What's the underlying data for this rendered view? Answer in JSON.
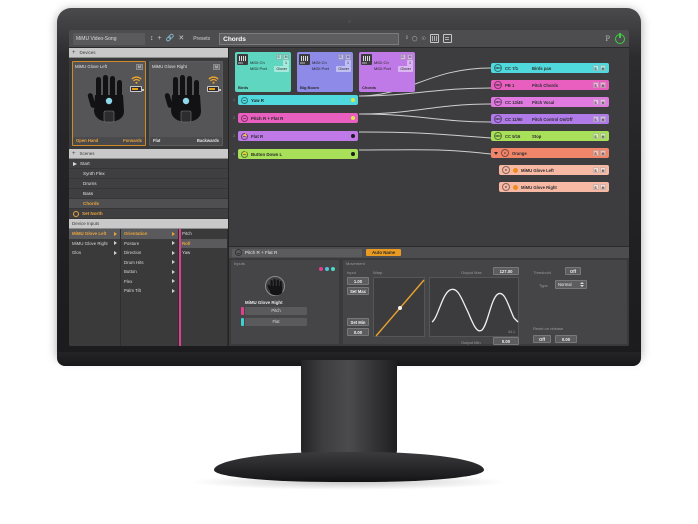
{
  "toolbar": {
    "song_title": "MiMU Video-Song",
    "icons": [
      "updown-arrows-icon",
      "plus-icon",
      "link-icon",
      "close-icon"
    ],
    "presets_label": "Presets",
    "scene_name_value": "Chords",
    "scene_name_placeholder": "Scene name",
    "right_icons": [
      "text-cursor-icon",
      "circle-icon",
      "balloon-icon",
      "keyboard-icon",
      "list-icon"
    ],
    "p_label": "P",
    "power_icon": "power-icon"
  },
  "devices_panel": {
    "header": "Devices",
    "items": [
      {
        "name": "MiMU Glove Left",
        "mute": "M",
        "posture": "Open Hand",
        "direction": "Forwards",
        "selected": true
      },
      {
        "name": "MiMU Glove Right",
        "mute": "M",
        "posture": "Flat",
        "direction": "Backwards",
        "selected": false
      }
    ]
  },
  "scenes_panel": {
    "header": "Scenes",
    "items": [
      {
        "label": "Start",
        "playing": true,
        "active": false,
        "gear": false
      },
      {
        "label": "Synth Flex",
        "playing": false,
        "active": false,
        "gear": false
      },
      {
        "label": "Drums",
        "playing": false,
        "active": false,
        "gear": false
      },
      {
        "label": "Bass",
        "playing": false,
        "active": false,
        "gear": false
      },
      {
        "label": "Chords",
        "playing": false,
        "active": true,
        "gear": false
      },
      {
        "label": "Set North",
        "playing": false,
        "active": false,
        "gear": true
      }
    ]
  },
  "device_inputs": {
    "header": "Device Inputs",
    "column_devices": [
      {
        "label": "MiMU Glove Left",
        "selected": true
      },
      {
        "label": "MiMU Glove Right",
        "selected": false
      },
      {
        "label": "Glos",
        "selected": false
      }
    ],
    "column_categories": [
      {
        "label": "Orientation",
        "selected": true
      },
      {
        "label": "Posture",
        "selected": false
      },
      {
        "label": "Direction",
        "selected": false
      },
      {
        "label": "Drum Hits",
        "selected": false
      },
      {
        "label": "Button",
        "selected": false
      },
      {
        "label": "Flex",
        "selected": false
      },
      {
        "label": "Palm Tilt",
        "selected": false
      }
    ],
    "column_values": [
      {
        "label": "Pitch",
        "selected": false
      },
      {
        "label": "Roll",
        "selected": true
      },
      {
        "label": "Yaw",
        "selected": false
      }
    ]
  },
  "canvas": {
    "midi_modules": [
      {
        "name": "Birds",
        "midi_ch_label": "MIDI Ch",
        "midi_ch": "1",
        "midi_port_label": "MIDI Port",
        "midi_port": "Glover",
        "solo": "S",
        "mute": "M",
        "color": "#5fd6c0"
      },
      {
        "name": "Big Boom",
        "midi_ch_label": "MIDI Ch",
        "midi_ch": "1",
        "midi_port_label": "MIDI Port",
        "midi_port": "Glover",
        "solo": "S",
        "mute": "M",
        "color": "#8e8ae8"
      },
      {
        "name": "Chords",
        "midi_ch_label": "MIDI Ch",
        "midi_ch": "1",
        "midi_port_label": "MIDI Port",
        "midi_port": "Glover",
        "solo": "S",
        "mute": "M",
        "color": "#c07ae8"
      }
    ],
    "source_nodes": [
      {
        "num": "1",
        "label": "Yaw R",
        "color": "#4fd9dd",
        "icon": "knob-icon",
        "dot": "#d9e84a"
      },
      {
        "num": "2",
        "label": "Pitch R + Flat R",
        "color": "#e85fc0",
        "icon": "knob-icon",
        "dot": "#d9e84a"
      },
      {
        "num": "3",
        "label": "Flat R",
        "color": "#c07ae8",
        "icon": "bolt-icon",
        "dot": "#1c1c1e"
      },
      {
        "num": "4",
        "label": "Button Down L",
        "color": "#a8e05a",
        "icon": "bolt-icon",
        "dot": "#1c1c1e"
      }
    ],
    "output_nodes": [
      {
        "cc": "CC 7/1",
        "label": "Birds pan",
        "color": "#4fd9dd",
        "solo": "S",
        "mute": "M",
        "type": "midi"
      },
      {
        "cc": "PB 1",
        "label": "Pitch Chords",
        "color": "#e85fc0",
        "solo": "S",
        "mute": "M",
        "type": "midi"
      },
      {
        "cc": "CC 13/45",
        "label": "Pitch Vocal",
        "color": "#e07ae0",
        "solo": "S",
        "mute": "M",
        "type": "midi"
      },
      {
        "cc": "CC 11/90",
        "label": "Pitch Control On/Off",
        "color": "#b07ae8",
        "solo": "S",
        "mute": "M",
        "type": "midi"
      },
      {
        "cc": "CC 5/16",
        "label": "Stop",
        "color": "#a8e05a",
        "solo": "S",
        "mute": "M",
        "type": "midi"
      }
    ],
    "group": {
      "label": "Orange",
      "color": "#f0856a",
      "solo": "S",
      "mute": "M",
      "children": [
        {
          "label": "MiMU Glove Left",
          "color": "#f7b8a4",
          "solo": "S",
          "mute": "M"
        },
        {
          "label": "MiMU Glove Right",
          "color": "#f7b8a4",
          "solo": "S",
          "mute": "M"
        }
      ]
    }
  },
  "editor": {
    "title": "Pitch R + Flat R",
    "auto_name_button": "Auto Name",
    "inputs": {
      "section_title": "Inputs",
      "device_name": "MiMU Glove Right",
      "buttons": [
        {
          "label": "Pitch",
          "tab_color": "#e0408f"
        },
        {
          "label": "Flat",
          "tab_color": "#3fd0cf"
        }
      ],
      "dots": [
        "#e0408f",
        "#4fc3d9",
        "#4fd9c0"
      ]
    },
    "movement": {
      "section_title": "Movement",
      "input_label": "Input",
      "input_max_value": "1.00",
      "set_max_label": "Set Max",
      "set_min_label": "Set Min",
      "input_min_value": "0.00",
      "warp_label": "Warp",
      "output_max_label": "Output Max",
      "output_max_value": "127.00",
      "output_min_label": "Output Min",
      "output_min_value": "0.00",
      "meter_value": "44.1",
      "threshold_label": "Threshold",
      "threshold_value": "Off",
      "type_label": "Type",
      "type_value": "Normal",
      "reset_label": "Reset on release",
      "reset_value": "Off",
      "reset_number": "0.00"
    }
  }
}
